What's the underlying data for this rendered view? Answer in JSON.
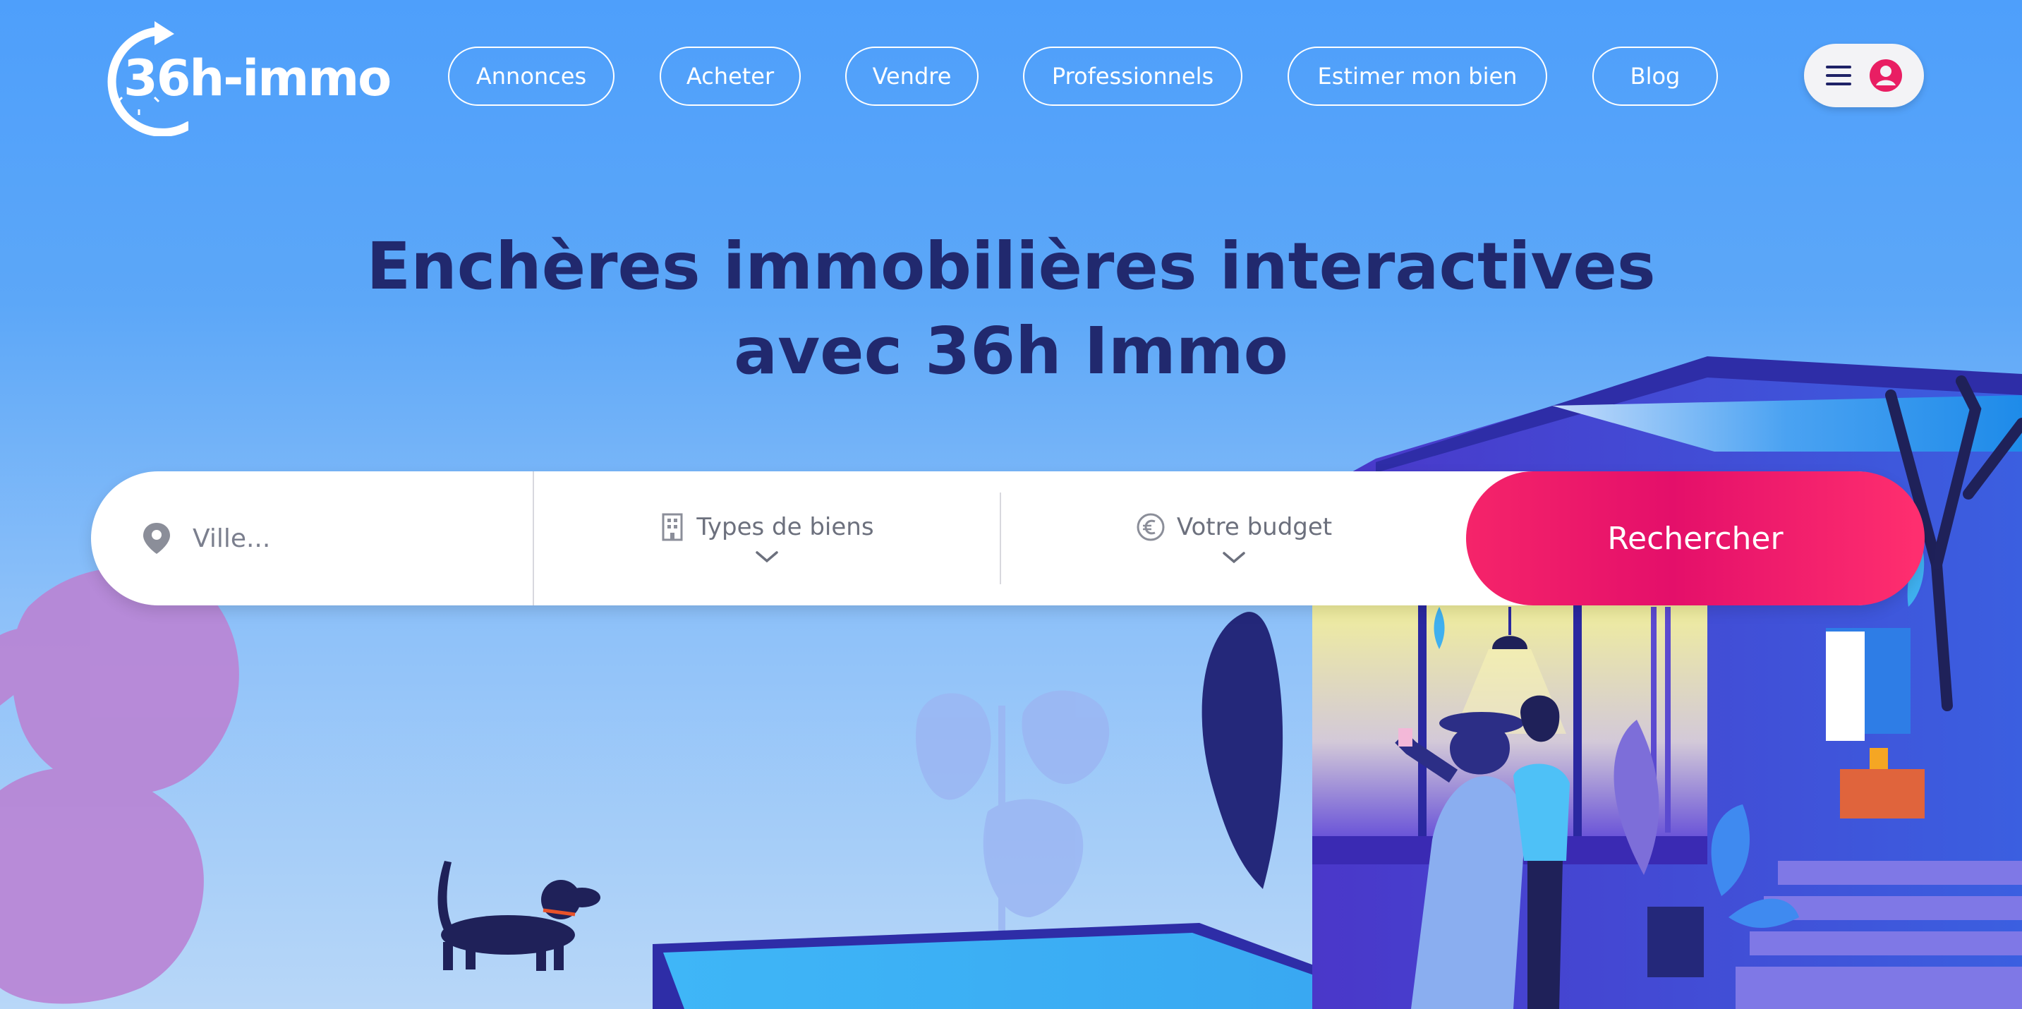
{
  "logo": {
    "text": "36h-immo"
  },
  "nav": {
    "items": [
      {
        "label": "Annonces"
      },
      {
        "label": "Acheter"
      },
      {
        "label": "Vendre"
      },
      {
        "label": "Professionnels"
      },
      {
        "label": "Estimer mon bien"
      },
      {
        "label": "Blog"
      }
    ],
    "menu_icon": "hamburger-icon",
    "account_icon": "user-circle-icon"
  },
  "hero": {
    "title_line1": "Enchères immobilières interactives",
    "title_line2": "avec 36h Immo"
  },
  "search": {
    "city_placeholder": "Ville...",
    "city_icon": "map-pin-icon",
    "property_type_label": "Types de biens",
    "property_type_icon": "building-icon",
    "budget_label": "Votre budget",
    "budget_icon": "euro-icon",
    "submit_label": "Rechercher"
  },
  "colors": {
    "background": "#4e9ffb",
    "title": "#21296e",
    "accent": "#f5246a",
    "account_icon": "#e91e63"
  }
}
